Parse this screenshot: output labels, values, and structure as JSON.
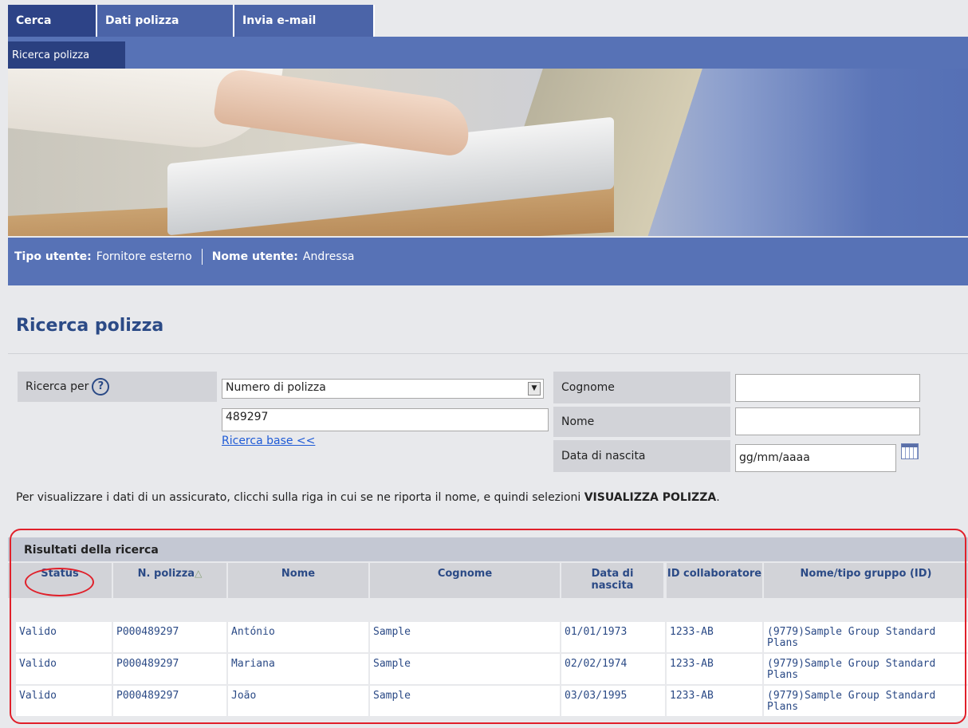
{
  "tabs": [
    {
      "label": "Cerca"
    },
    {
      "label": "Dati polizza"
    },
    {
      "label": "Invia e-mail"
    }
  ],
  "subnav": {
    "active_label": "Ricerca polizza"
  },
  "userbar": {
    "tipo_label": "Tipo utente:",
    "tipo_value": "Fornitore esterno",
    "nome_label": "Nome utente:",
    "nome_value": "Andressa"
  },
  "page_title": "Ricerca polizza",
  "form": {
    "ricerca_per_label": "Ricerca per",
    "help_icon": "?",
    "select_value": "Numero di polizza",
    "policy_input_value": "489297",
    "ricerca_base_link": "Ricerca base <<",
    "cognome_label": "Cognome",
    "cognome_value": "",
    "nome_label": "Nome",
    "nome_value": "",
    "data_label": "Data di nascita",
    "data_value": "gg/mm/aaaa"
  },
  "instruction": {
    "text": "Per visualizzare i dati di un assicurato, clicchi sulla riga in cui se ne riporta il nome, e quindi selezioni ",
    "bold": "VISUALIZZA POLIZZA",
    "end": "."
  },
  "results": {
    "title": "Risultati della ricerca",
    "headers": [
      "Status",
      "N. polizza",
      "Nome",
      "Cognome",
      "Data di nascita",
      "ID collaboratore",
      "Nome/tipo gruppo (ID)"
    ],
    "rows": [
      [
        "Valido",
        "P000489297",
        "António",
        "Sample",
        "01/01/1973",
        "1233-AB",
        "(9779)Sample Group Standard Plans"
      ],
      [
        "Valido",
        "P000489297",
        "Mariana",
        "Sample",
        "02/02/1974",
        "1233-AB",
        "(9779)Sample Group Standard Plans"
      ],
      [
        "Valido",
        "P000489297",
        "João",
        "Sample",
        "03/03/1995",
        "1233-AB",
        "(9779)Sample Group Standard Plans"
      ]
    ]
  }
}
